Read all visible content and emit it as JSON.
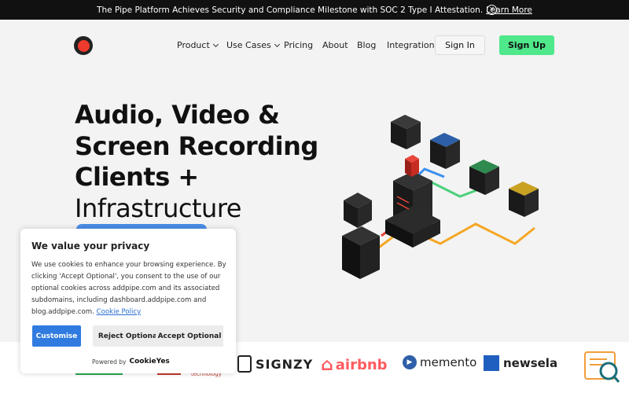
{
  "announcement": {
    "text": "The Pipe Platform Achieves Security and Compliance Milestone with SOC 2 Type I Attestation.",
    "link": "Learn More"
  },
  "nav": {
    "items": [
      {
        "label": "Product",
        "dropdown": true
      },
      {
        "label": "Use Cases",
        "dropdown": true
      },
      {
        "label": "Pricing"
      },
      {
        "label": "About"
      },
      {
        "label": "Blog"
      },
      {
        "label": "Integrations"
      }
    ],
    "signin": "Sign In",
    "signup": "Sign Up"
  },
  "hero": {
    "line1": "Audio, Video &",
    "line2": "Screen Recording",
    "line3": "Clients +",
    "line4": "Infrastructure"
  },
  "cookie": {
    "title": "We value your privacy",
    "body": "We use cookies to enhance your browsing experience. By clicking 'Accept Optional', you consent to the use of our optional cookies across addpipe.com and its associated subdomains, including dashboard.addpipe.com and blog.addpipe.com.",
    "policy_link": "Cookie Policy",
    "customise": "Customise",
    "reject": "Reject Optional",
    "accept": "Accept Optional",
    "powered_by": "Powered by",
    "powered_brand": "CookieYes"
  },
  "logos": {
    "technology": "technology",
    "signzy": "SIGNZY",
    "airbnb": "airbnb",
    "memento": "memento",
    "newsela": "newsela"
  },
  "colors": {
    "accent_green": "#4fe88a",
    "primary_blue": "#2f7be0",
    "logo_red": "#ef3b2d",
    "airbnb": "#ff5a5f",
    "newsela": "#1f5fbf"
  }
}
